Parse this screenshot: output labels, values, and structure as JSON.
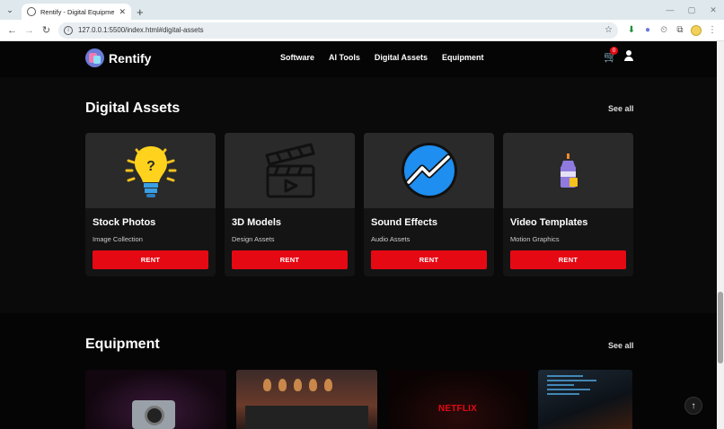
{
  "browser": {
    "tab_title": "Rentify - Digital Equipment Ren",
    "tab_close": "✕",
    "new_tab": "+",
    "url": "127.0.0.1:5500/index.html#digital-assets",
    "window_controls": [
      "—",
      "▢",
      "✕"
    ]
  },
  "nav": {
    "brand": "Rentify",
    "links": [
      "Software",
      "AI Tools",
      "Digital Assets",
      "Equipment"
    ],
    "cart_count": "0"
  },
  "digital_assets": {
    "title": "Digital Assets",
    "see_all": "See all",
    "cards": [
      {
        "name": "Stock Photos",
        "category": "Image Collection",
        "button": "RENT",
        "icon": "lightbulb-question-icon"
      },
      {
        "name": "3D Models",
        "category": "Design Assets",
        "button": "RENT",
        "icon": "clapperboard-icon"
      },
      {
        "name": "Sound Effects",
        "category": "Audio Assets",
        "button": "RENT",
        "icon": "trend-line-icon"
      },
      {
        "name": "Video Templates",
        "category": "Motion Graphics",
        "button": "RENT",
        "icon": "paint-bottle-icon"
      }
    ]
  },
  "equipment": {
    "title": "Equipment",
    "see_all": "See all",
    "netflix_text": "NETFLIX"
  },
  "colors": {
    "accent": "#e50914",
    "background": "#0a0a0a",
    "card": "#141414"
  }
}
